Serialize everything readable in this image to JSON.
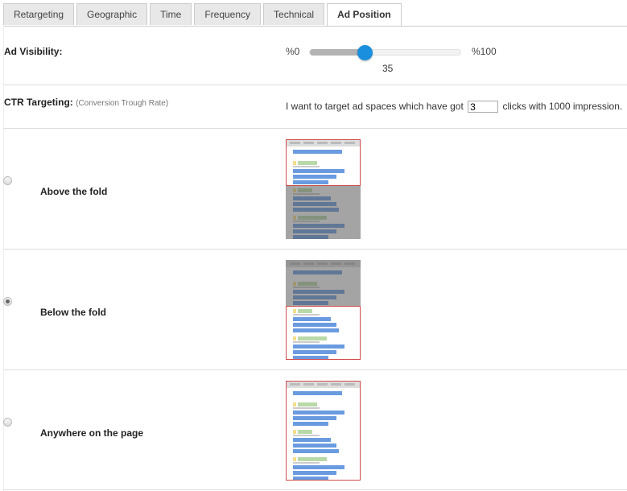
{
  "tabs": [
    {
      "label": "Retargeting",
      "active": false
    },
    {
      "label": "Geographic",
      "active": false
    },
    {
      "label": "Time",
      "active": false
    },
    {
      "label": "Frequency",
      "active": false
    },
    {
      "label": "Technical",
      "active": false
    },
    {
      "label": "Ad Position",
      "active": true
    }
  ],
  "ad_visibility": {
    "label": "Ad Visibility:",
    "min_label": "%0",
    "max_label": "%100",
    "value": 35,
    "value_label": "35",
    "fill_color": "#b3b3b3",
    "thumb_color": "#1a8fdd"
  },
  "ctr_targeting": {
    "label": "CTR Targeting:",
    "sublabel": "(Conversion Trough Rate)",
    "text_before": "I want to target ad spaces which have got",
    "input_value": "3",
    "text_after": "clicks with 1000 impression."
  },
  "positions": [
    {
      "label": "Above the fold",
      "selected": false,
      "highlight": "top",
      "preview_icon": "above-fold-preview"
    },
    {
      "label": "Below the fold",
      "selected": true,
      "highlight": "bottom",
      "preview_icon": "below-fold-preview"
    },
    {
      "label": "Anywhere on the page",
      "selected": false,
      "highlight": "all",
      "preview_icon": "anywhere-preview"
    }
  ],
  "colors": {
    "highlight_border": "#d24b4b",
    "accent": "#1a8fdd"
  }
}
